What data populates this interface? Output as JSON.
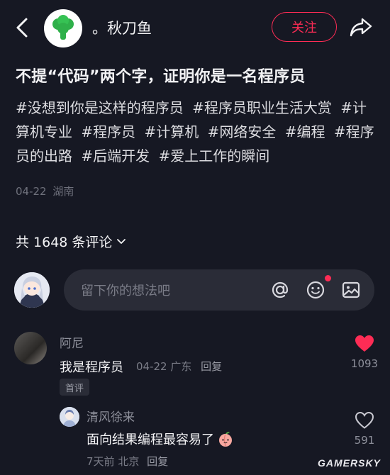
{
  "header": {
    "author_name": "。秋刀鱼",
    "follow_label": "关注",
    "back_icon": "back-arrow-icon",
    "share_icon": "share-arrow-icon",
    "avatar_icon": "green-broccoli-icon"
  },
  "post": {
    "title": "不提“代码”两个字，证明你是一名程序员",
    "hashtags": [
      "#没想到你是这样的程序员",
      "#程序员职业生活大赏",
      "#计算机专业",
      "#程序员",
      "#计算机",
      "#网络安全",
      "#编程",
      "#程序员的出路",
      "#后端开发",
      "#爱上工作的瞬间"
    ],
    "date": "04-22",
    "location": "湖南"
  },
  "comments_header": {
    "label": "共 1648 条评论"
  },
  "composer": {
    "placeholder": "留下你的想法吧",
    "icons": [
      "at-icon",
      "emoji-icon",
      "image-icon"
    ]
  },
  "comments": [
    {
      "author": "阿尼",
      "text": "我是程序员",
      "date": "04-22",
      "location": "广东",
      "reply": "回复",
      "badge": "首评",
      "likes": "1093",
      "liked": true
    },
    {
      "author": "清风徐来",
      "text": "面向结果编程最容易了",
      "date": "7天前",
      "location": "北京",
      "reply": "回复",
      "likes": "591",
      "liked": false
    }
  ],
  "watermark": "GAMERSKY",
  "colors": {
    "background": "#161823",
    "accent": "#fe2c55",
    "input_bg": "#2a2c37"
  }
}
